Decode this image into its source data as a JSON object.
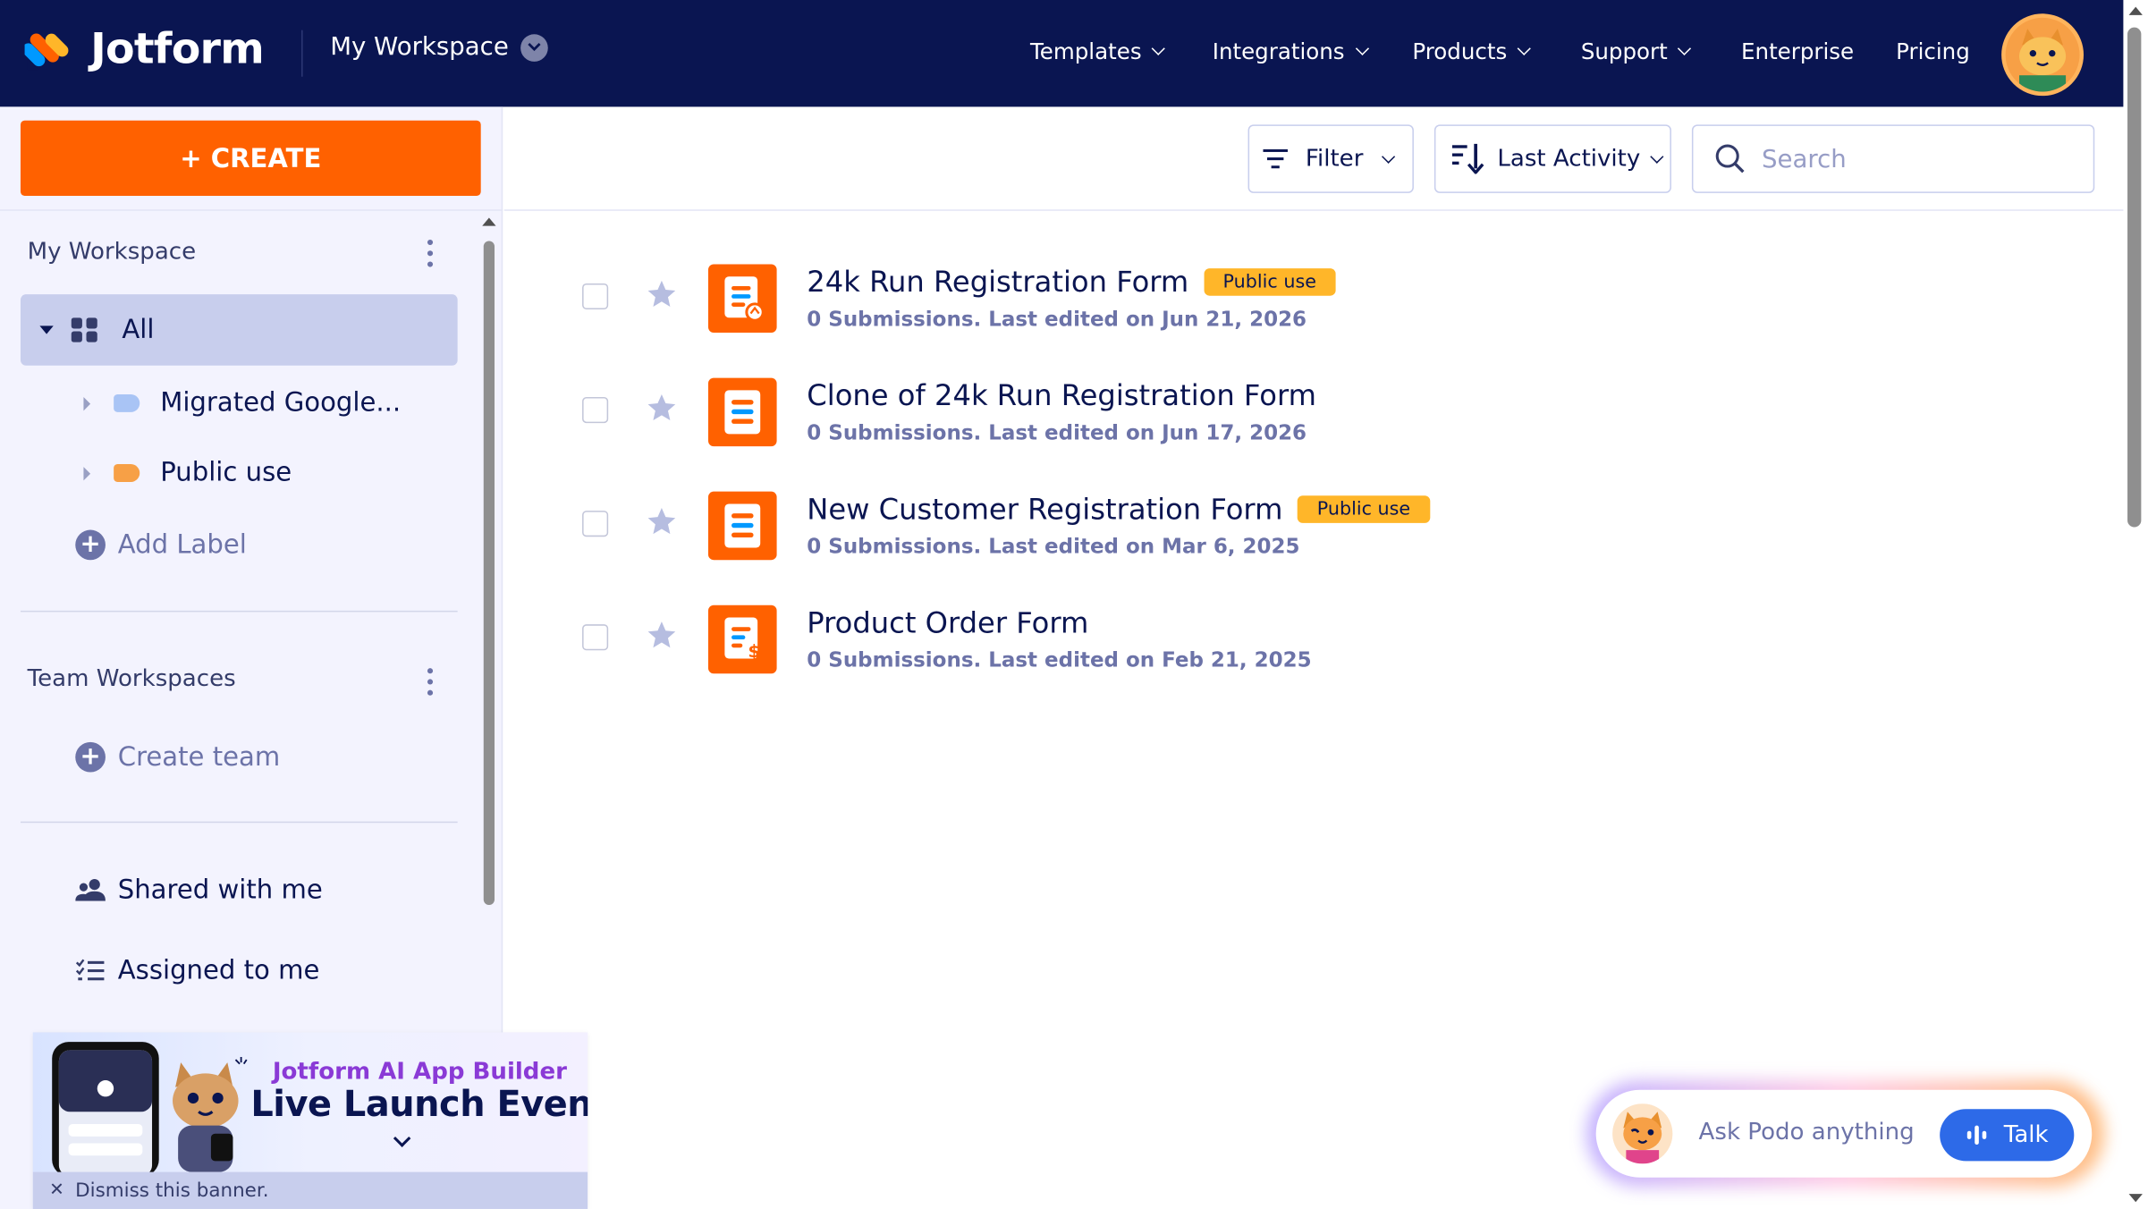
{
  "brand": {
    "name": "Jotform",
    "accent": "#ff6100",
    "navy": "#0a1551"
  },
  "header": {
    "workspace_label": "My Workspace",
    "nav": [
      {
        "label": "Templates",
        "has_dropdown": true
      },
      {
        "label": "Integrations",
        "has_dropdown": true
      },
      {
        "label": "Products",
        "has_dropdown": true
      },
      {
        "label": "Support",
        "has_dropdown": true
      },
      {
        "label": "Enterprise",
        "has_dropdown": false
      },
      {
        "label": "Pricing",
        "has_dropdown": false
      }
    ],
    "avatar_icon": "cat-avatar-icon"
  },
  "sidebar": {
    "create_label": "+ CREATE",
    "my_workspace_title": "My Workspace",
    "all_label": "All",
    "labels": [
      {
        "label": "Migrated Google...",
        "color": "#a9c4f5"
      },
      {
        "label": "Public use",
        "color": "#f7a046"
      }
    ],
    "add_label": "Add Label",
    "team_title": "Team Workspaces",
    "create_team": "Create team",
    "shared_with_me": "Shared with me",
    "assigned_to_me": "Assigned to me"
  },
  "toolbar": {
    "filter_label": "Filter",
    "sort_label": "Last Activity",
    "search_placeholder": "Search"
  },
  "forms": [
    {
      "title": "24k Run Registration Form",
      "badge": "Public use",
      "meta": "0 Submissions. Last edited on Jun 21, 2026",
      "icon": "form-run-icon"
    },
    {
      "title": "Clone of 24k Run Registration Form",
      "badge": "",
      "meta": "0 Submissions. Last edited on Jun 17, 2026",
      "icon": "form-icon"
    },
    {
      "title": "New Customer Registration Form",
      "badge": "Public use",
      "meta": "0 Submissions. Last edited on Mar 6, 2025",
      "icon": "form-icon"
    },
    {
      "title": "Product Order Form",
      "badge": "",
      "meta": "0 Submissions. Last edited on Feb 21, 2025",
      "icon": "form-payment-icon"
    }
  ],
  "banner": {
    "line1": "Jotform AI App Builder",
    "line2": "Live Launch Event",
    "dismiss": "Dismiss this banner."
  },
  "assistant": {
    "placeholder": "Ask Podo anything",
    "talk_label": "Talk"
  }
}
